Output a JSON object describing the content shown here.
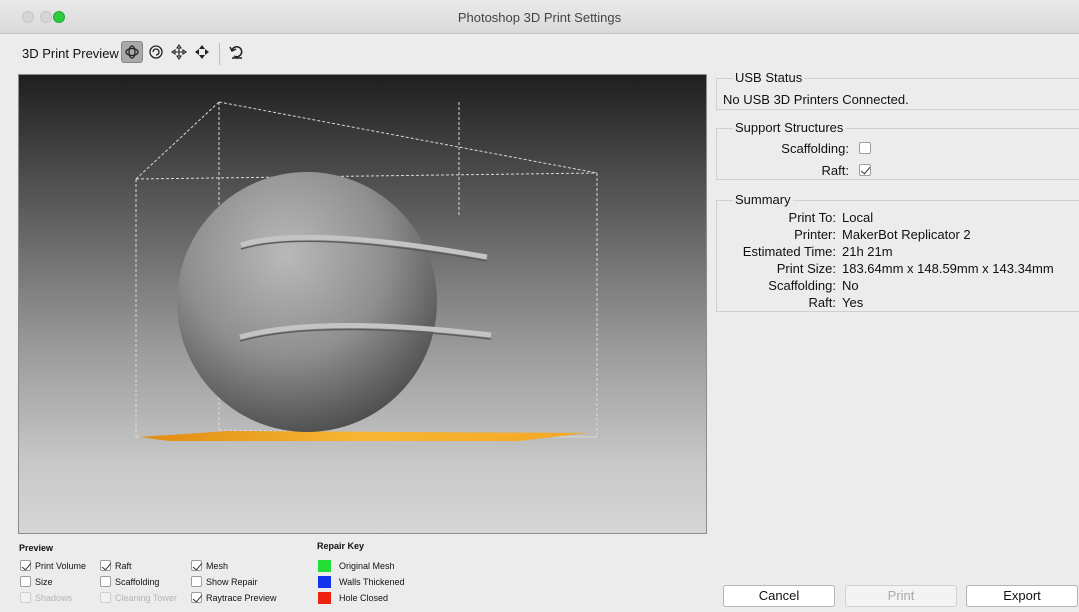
{
  "window": {
    "title": "Photoshop 3D Print Settings"
  },
  "toolbar": {
    "label": "3D Print Preview",
    "tools": [
      "rotate-3d-icon",
      "roll-icon",
      "pan-icon",
      "slide-icon",
      "reset-view-icon"
    ]
  },
  "usb_status": {
    "title": "USB Status",
    "message": "No USB 3D Printers Connected."
  },
  "support": {
    "title": "Support Structures",
    "scaffolding_label": "Scaffolding:",
    "scaffolding_checked": false,
    "raft_label": "Raft:",
    "raft_checked": true
  },
  "summary": {
    "title": "Summary",
    "rows": [
      {
        "key": "Print To:",
        "value": "Local"
      },
      {
        "key": "Printer:",
        "value": "MakerBot Replicator 2"
      },
      {
        "key": "Estimated Time:",
        "value": "21h 21m"
      },
      {
        "key": "Print Size:",
        "value": "183.64mm x 148.59mm x 143.34mm"
      },
      {
        "key": "Scaffolding:",
        "value": "No"
      },
      {
        "key": "Raft:",
        "value": "Yes"
      }
    ]
  },
  "preview": {
    "title": "Preview",
    "options": [
      {
        "label": "Print Volume",
        "checked": true,
        "enabled": true
      },
      {
        "label": "Size",
        "checked": false,
        "enabled": true
      },
      {
        "label": "Shadows",
        "checked": false,
        "enabled": false
      },
      {
        "label": "Raft",
        "checked": true,
        "enabled": true
      },
      {
        "label": "Scaffolding",
        "checked": false,
        "enabled": true
      },
      {
        "label": "Cleaning Tower",
        "checked": false,
        "enabled": false
      },
      {
        "label": "Mesh",
        "checked": true,
        "enabled": true
      },
      {
        "label": "Show Repair",
        "checked": false,
        "enabled": true
      },
      {
        "label": "Raytrace Preview",
        "checked": true,
        "enabled": true
      }
    ]
  },
  "repair_key": {
    "title": "Repair Key",
    "items": [
      {
        "label": "Original Mesh",
        "color": "#22dd33"
      },
      {
        "label": "Walls Thickened",
        "color": "#1133ee"
      },
      {
        "label": "Hole Closed",
        "color": "#ee2211"
      }
    ]
  },
  "buttons": {
    "cancel": "Cancel",
    "print": "Print",
    "export": "Export"
  },
  "colors": {
    "raft": "#f5a623",
    "accent_green": "#2ecc40"
  }
}
